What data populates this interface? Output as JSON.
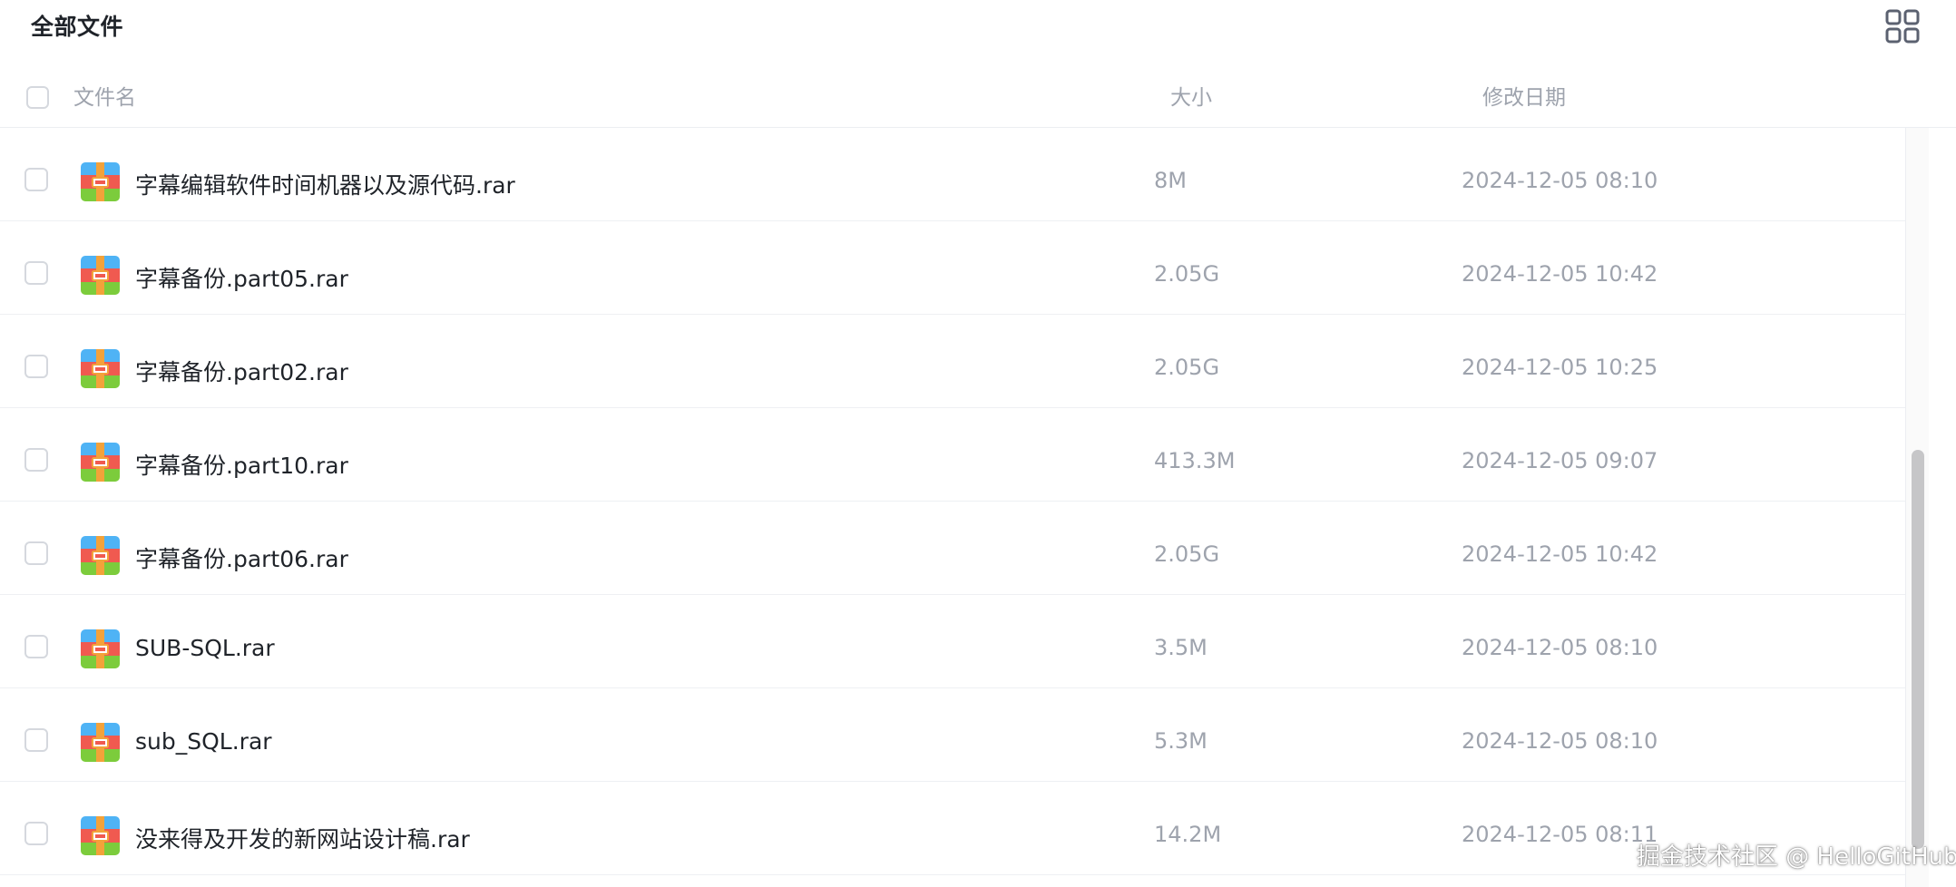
{
  "title": "全部文件",
  "view_toggle_icon": "grid-view-icon",
  "columns": {
    "name": "文件名",
    "size": "大小",
    "date": "修改日期"
  },
  "files": [
    {
      "name": "字幕编辑软件时间机器以及源代码.rar",
      "size": "8M",
      "date": "2024-12-05 08:10",
      "icon": "rar-archive-icon"
    },
    {
      "name": "字幕备份.part05.rar",
      "size": "2.05G",
      "date": "2024-12-05 10:42",
      "icon": "rar-archive-icon"
    },
    {
      "name": "字幕备份.part02.rar",
      "size": "2.05G",
      "date": "2024-12-05 10:25",
      "icon": "rar-archive-icon"
    },
    {
      "name": "字幕备份.part10.rar",
      "size": "413.3M",
      "date": "2024-12-05 09:07",
      "icon": "rar-archive-icon"
    },
    {
      "name": "字幕备份.part06.rar",
      "size": "2.05G",
      "date": "2024-12-05 10:42",
      "icon": "rar-archive-icon"
    },
    {
      "name": "SUB-SQL.rar",
      "size": "3.5M",
      "date": "2024-12-05 08:10",
      "icon": "rar-archive-icon"
    },
    {
      "name": "sub_SQL.rar",
      "size": "5.3M",
      "date": "2024-12-05 08:10",
      "icon": "rar-archive-icon"
    },
    {
      "name": "没来得及开发的新网站设计稿.rar",
      "size": "14.2M",
      "date": "2024-12-05 08:11",
      "icon": "rar-archive-icon"
    }
  ],
  "colors": {
    "text_primary": "#1f2329",
    "text_secondary": "#9ea3ad",
    "icon_blue": "#4fb3f5",
    "icon_red": "#f05a50",
    "icon_green": "#7ccc3c",
    "icon_orange": "#f3a23a"
  },
  "watermark": "掘金技术社区 @ HelloGitHub"
}
